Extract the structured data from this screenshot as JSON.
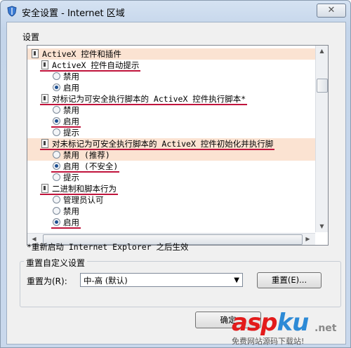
{
  "window": {
    "title": "安全设置 - Internet 区域",
    "close_glyph": "✕"
  },
  "settings_label": "设置",
  "tree": [
    {
      "type": "group",
      "label": "ActiveX 控件和插件",
      "highlight": true
    },
    {
      "type": "setting",
      "label": "ActiveX 控件自动提示",
      "underline": true
    },
    {
      "type": "option",
      "label": "禁用",
      "checked": false
    },
    {
      "type": "option",
      "label": "启用",
      "checked": true
    },
    {
      "type": "setting",
      "label": "对标记为可安全执行脚本的 ActiveX 控件执行脚本*",
      "underline": true
    },
    {
      "type": "option",
      "label": "禁用",
      "checked": false
    },
    {
      "type": "option",
      "label": "启用",
      "checked": true,
      "underline": true
    },
    {
      "type": "option",
      "label": "提示",
      "checked": false
    },
    {
      "type": "setting",
      "label": "对未标记为可安全执行脚本的 ActiveX 控件初始化并执行脚",
      "highlight": true,
      "underline": true
    },
    {
      "type": "option",
      "label": "禁用 (推荐)",
      "checked": false,
      "highlight": true
    },
    {
      "type": "option",
      "label": "启用 (不安全)",
      "checked": true,
      "underline": true
    },
    {
      "type": "option",
      "label": "提示",
      "checked": false
    },
    {
      "type": "setting",
      "label": "二进制和脚本行为",
      "underline": true
    },
    {
      "type": "option",
      "label": "管理员认可",
      "checked": false
    },
    {
      "type": "option",
      "label": "禁用",
      "checked": false
    },
    {
      "type": "option",
      "label": "启用",
      "checked": true,
      "underline": true
    }
  ],
  "restart_note": "*重新启动 Internet Explorer 之后生效",
  "reset_group": {
    "title": "重置自定义设置",
    "reset_to_label": "重置为(R):",
    "selected_level": "中-高 (默认)",
    "reset_button": "重置(E)..."
  },
  "ok_button": "确定",
  "watermark": {
    "brand_a": "asp",
    "brand_b": "ku",
    "suffix": ".net",
    "subtitle": "免费网站源码下载站!"
  },
  "colors": {
    "highlight": "#fbe3d2",
    "underline": "#c0143c"
  }
}
